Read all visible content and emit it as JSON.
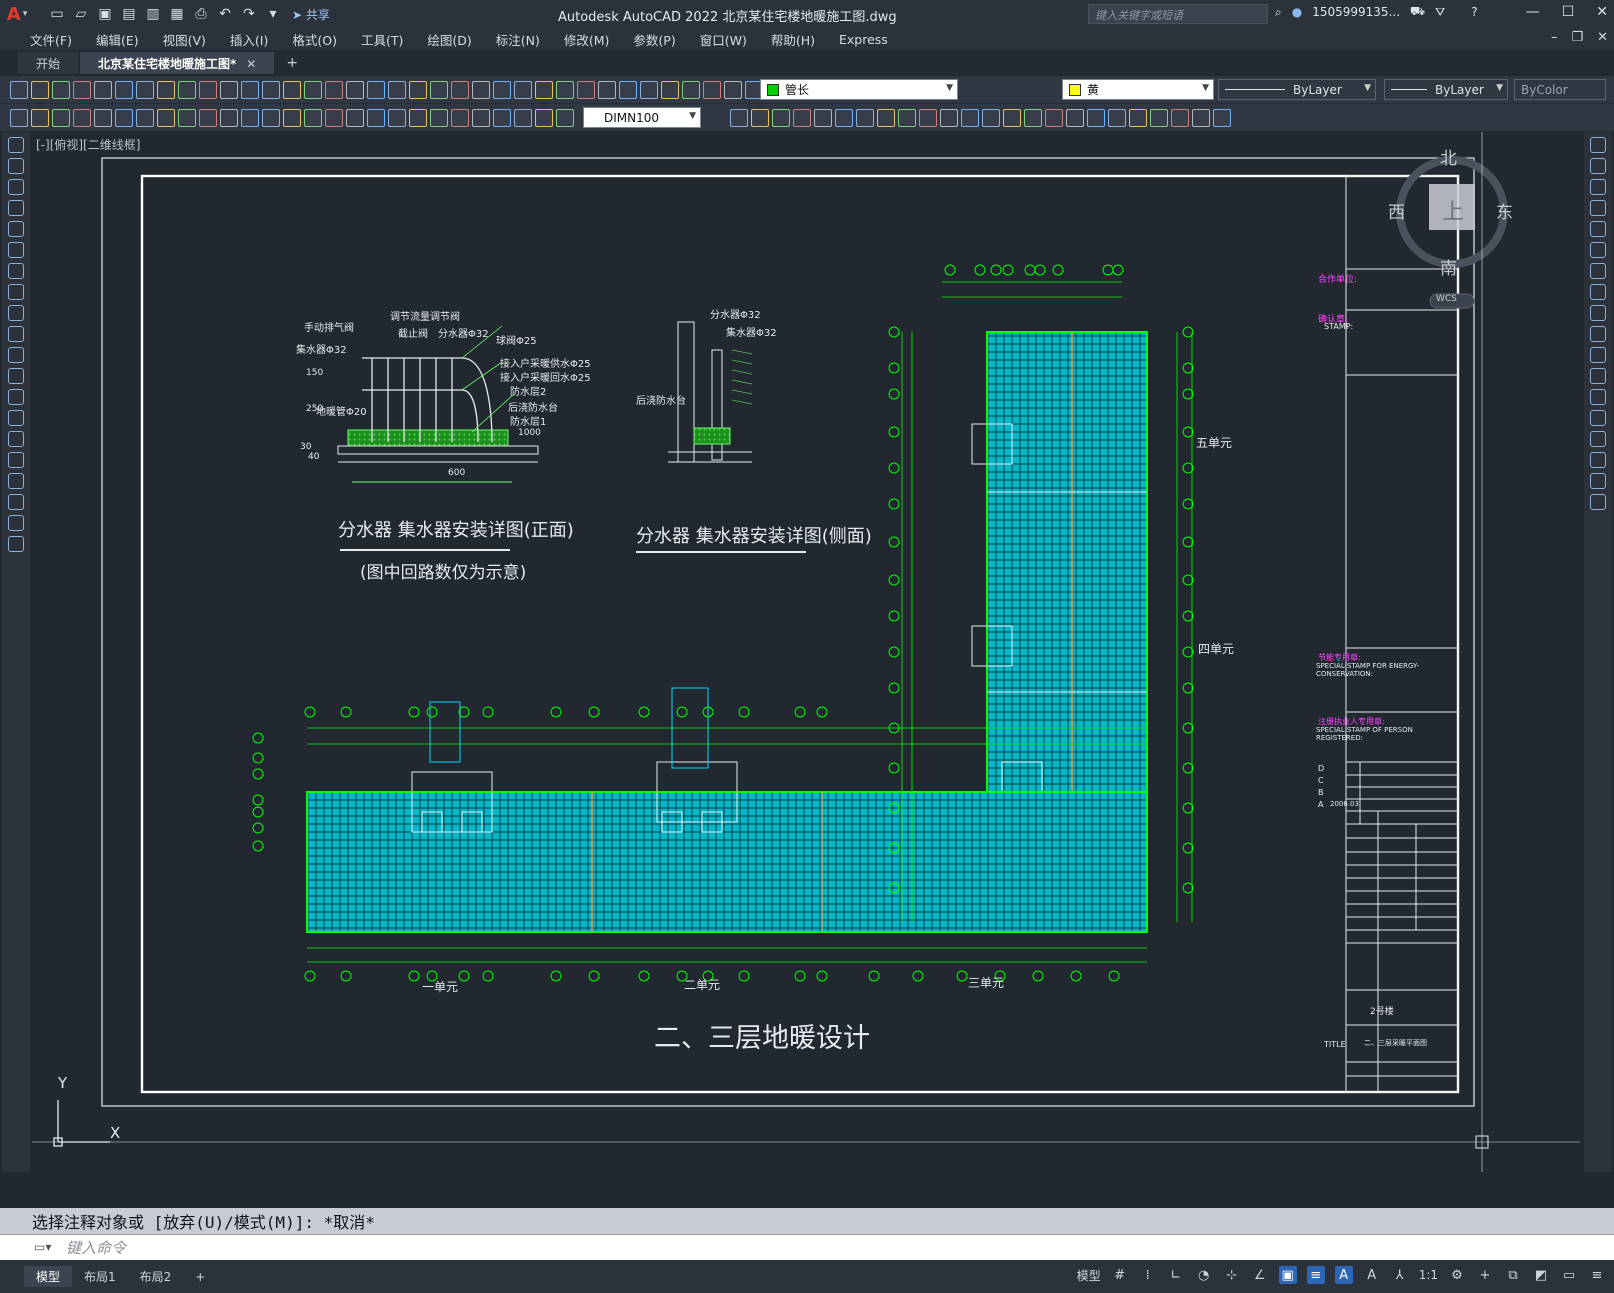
{
  "app": {
    "title": "Autodesk AutoCAD 2022    北京某住宅楼地暖施工图.dwg",
    "logo": "A",
    "share_label": "共享",
    "search_placeholder": "键入关键字或短语",
    "user_name": "1505999135...",
    "accent_color": "#2d66b4"
  },
  "menu": {
    "items": [
      "文件(F)",
      "编辑(E)",
      "视图(V)",
      "插入(I)",
      "格式(O)",
      "工具(T)",
      "绘图(D)",
      "标注(N)",
      "修改(M)",
      "参数(P)",
      "窗口(W)",
      "帮助(H)",
      "Express"
    ]
  },
  "tabs": {
    "items": [
      {
        "label": "开始"
      },
      {
        "label": "北京某住宅楼地暖施工图*"
      }
    ],
    "close_glyph": "✕",
    "add_glyph": "+"
  },
  "toolbar": {
    "layer_name": "管长",
    "layer_color": "#00d000",
    "color_name": "黄",
    "color_value": "#ffff00",
    "linetype": "ByLayer",
    "lineweight": "ByLayer",
    "plotstyle": "ByColor",
    "dimstyle": "DIMN100"
  },
  "viewport": {
    "label": "[-][俯视][二维线框]",
    "viewcube": {
      "north": "北",
      "south": "南",
      "west": "西",
      "east": "东",
      "top": "上",
      "wcs": "WCS"
    },
    "ucs_x": "X",
    "ucs_y": "Y"
  },
  "drawing": {
    "detail_front_title": "分水器 集水器安装详图(正面)",
    "detail_front_note": "(图中回路数仅为示意)",
    "detail_side_title": "分水器 集水器安装详图(侧面)",
    "main_title": "二、三层地暖设计",
    "unit1": "一单元",
    "unit2": "二单元",
    "unit3": "三单元",
    "unit4": "四单元",
    "unit5": "五单元",
    "front_labels": [
      "手动排气阀",
      "调节流量调节阀",
      "截止阀",
      "分水器Φ32",
      "球阀Φ25",
      "集水器Φ32",
      "接入户采暖供水Φ25",
      "接入户采暖回水Φ25",
      "防水层2",
      "地暖管Φ20",
      "后浇防水台",
      "防水层1"
    ],
    "front_dims": [
      "150",
      "250",
      "30",
      "40",
      "1000",
      "600"
    ],
    "side_labels": [
      "分水器Φ32",
      "集水器Φ32",
      "后浇防水台"
    ],
    "titleblock": {
      "owner": "合作单位:",
      "confirm": "确认章:",
      "stamp": "STAMP:",
      "energy": "节能专用章:",
      "energy_en": "SPECIAL STAMP FOR ENERGY-CONSERVATION:",
      "reg": "注册执业人专用章:",
      "reg_en": "SPECIAL STAMP OF PERSON REGISTERED:",
      "rev_rows": [
        "D",
        "C",
        "B",
        "A"
      ],
      "rev_date": "2006.03",
      "project": "2号楼",
      "title_label": "TITLE",
      "sheet_title": "二、三层采暖平面图"
    }
  },
  "command": {
    "history": "选择注释对象或 [放弃(U)/模式(M)]: *取消*",
    "placeholder": "键入命令"
  },
  "status": {
    "layouts": [
      "模型",
      "布局1",
      "布局2"
    ],
    "model_label": "模型",
    "scale": "1:1"
  }
}
